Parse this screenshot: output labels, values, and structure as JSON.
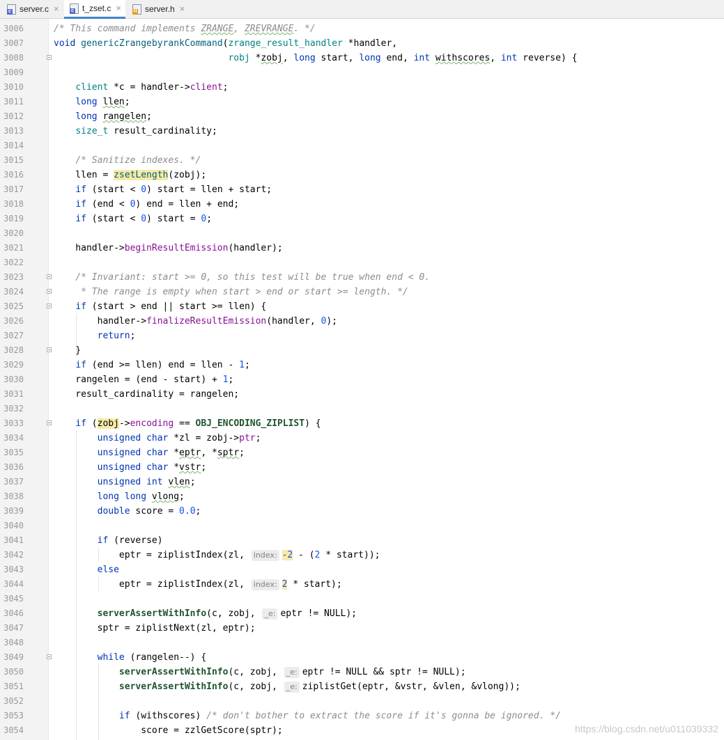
{
  "tabs": [
    {
      "label": "server.c",
      "icon": "c-file-icon",
      "active": false
    },
    {
      "label": "t_zset.c",
      "icon": "c-file-icon",
      "active": true
    },
    {
      "label": "server.h",
      "icon": "h-file-icon",
      "active": false
    }
  ],
  "line_numbers": [
    "3006",
    "3007",
    "3008",
    "3009",
    "3010",
    "3011",
    "3012",
    "3013",
    "3014",
    "3015",
    "3016",
    "3017",
    "3018",
    "3019",
    "3020",
    "3021",
    "3022",
    "3023",
    "3024",
    "3025",
    "3026",
    "3027",
    "3028",
    "3029",
    "3030",
    "3031",
    "3032",
    "3033",
    "3034",
    "3035",
    "3036",
    "3037",
    "3038",
    "3039",
    "3040",
    "3041",
    "3042",
    "3043",
    "3044",
    "3045",
    "3046",
    "3047",
    "3048",
    "3049",
    "3050",
    "3051",
    "3052",
    "3053",
    "3054"
  ],
  "code": {
    "l3006": "/* This command implements ZRANGE, ZREVRANGE. */",
    "l3007": "void genericZrangebyrankCommand(zrange_result_handler *handler,",
    "l3008": "                                robj *zobj, long start, long end, int withscores, int reverse) {",
    "l3010": "    client *c = handler->client;",
    "l3011": "    long llen;",
    "l3012": "    long rangelen;",
    "l3013": "    size_t result_cardinality;",
    "l3015": "    /* Sanitize indexes. */",
    "l3016": "    llen = zsetLength(zobj);",
    "l3017": "    if (start < 0) start = llen + start;",
    "l3018": "    if (end < 0) end = llen + end;",
    "l3019": "    if (start < 0) start = 0;",
    "l3021": "    handler->beginResultEmission(handler);",
    "l3023": "    /* Invariant: start >= 0, so this test will be true when end < 0.",
    "l3024": "     * The range is empty when start > end or start >= length. */",
    "l3025": "    if (start > end || start >= llen) {",
    "l3026": "        handler->finalizeResultEmission(handler, 0);",
    "l3027": "        return;",
    "l3028": "    }",
    "l3029": "    if (end >= llen) end = llen - 1;",
    "l3030": "    rangelen = (end - start) + 1;",
    "l3031": "    result_cardinality = rangelen;",
    "l3033": "    if (zobj->encoding == OBJ_ENCODING_ZIPLIST) {",
    "l3034": "        unsigned char *zl = zobj->ptr;",
    "l3035": "        unsigned char *eptr, *sptr;",
    "l3036": "        unsigned char *vstr;",
    "l3037": "        unsigned int vlen;",
    "l3038": "        long long vlong;",
    "l3039": "        double score = 0.0;",
    "l3041": "        if (reverse)",
    "l3042": "            eptr = ziplistIndex(zl, index: -2 - (2 * start));",
    "l3043": "        else",
    "l3044": "            eptr = ziplistIndex(zl, index: 2 * start);",
    "l3046": "        serverAssertWithInfo(c, zobj, _e: eptr != NULL);",
    "l3047": "        sptr = ziplistNext(zl, eptr);",
    "l3049": "        while (rangelen--) {",
    "l3050": "            serverAssertWithInfo(c, zobj, _e: eptr != NULL && sptr != NULL);",
    "l3051": "            serverAssertWithInfo(c, zobj, _e: ziplistGet(eptr, &vstr, &vlen, &vlong));",
    "l3053": "            if (withscores) /* don't bother to extract the score if it's gonna be ignored. */",
    "l3054": "                score = zzlGetScore(sptr);"
  },
  "watermark": "https://blog.csdn.net/u011039332",
  "colors": {
    "keyword": "#0033b3",
    "number": "#1750eb",
    "comment": "#8c8c8c",
    "function": "#00627a",
    "member": "#871094",
    "type": "#008080",
    "highlight": "#f7eaa6",
    "tab_underline": "#4083c9"
  }
}
